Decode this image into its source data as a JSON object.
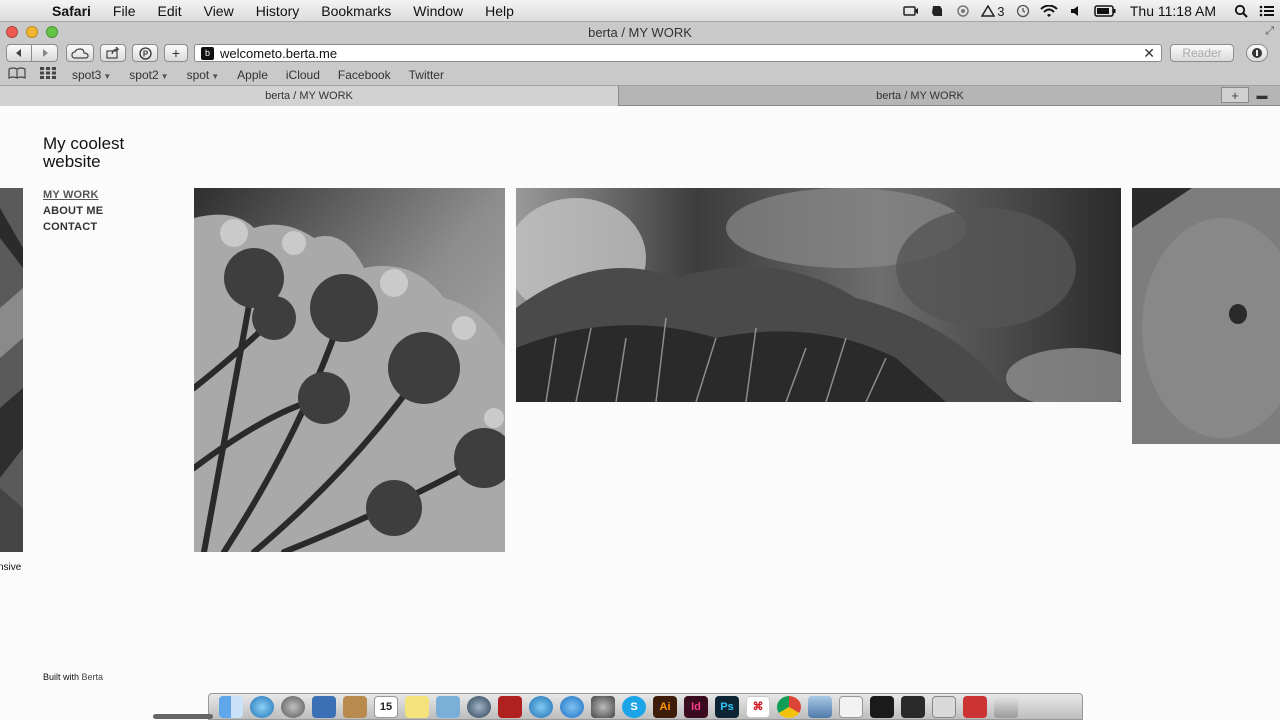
{
  "menubar": {
    "app_name": "Safari",
    "menus": [
      "File",
      "Edit",
      "View",
      "History",
      "Bookmarks",
      "Window",
      "Help"
    ],
    "status_icons": [
      "camera-icon",
      "evernote-icon",
      "sync-icon",
      "adobe-icon",
      "time-machine-icon",
      "wifi-icon",
      "volume-icon",
      "battery-icon"
    ],
    "adobe_count": "3",
    "clock": "Thu 11:18 AM"
  },
  "window": {
    "title": "berta / MY WORK"
  },
  "toolbar": {
    "url": "welcometo.berta.me",
    "favicon_letter": "b",
    "reader_label": "Reader",
    "add_label": "+"
  },
  "bookmarks": {
    "items": [
      {
        "label": "spot3",
        "has_menu": true
      },
      {
        "label": "spot2",
        "has_menu": true
      },
      {
        "label": "spot",
        "has_menu": true
      },
      {
        "label": "Apple",
        "has_menu": false
      },
      {
        "label": "iCloud",
        "has_menu": false
      },
      {
        "label": "Facebook",
        "has_menu": false
      },
      {
        "label": "Twitter",
        "has_menu": false
      }
    ]
  },
  "tabs": [
    {
      "label": "berta / MY WORK",
      "active": true
    },
    {
      "label": "berta / MY WORK",
      "active": false
    }
  ],
  "page": {
    "site_title": "My coolest website",
    "nav": [
      {
        "label": "MY WORK",
        "current": true
      },
      {
        "label": "ABOUT ME",
        "current": false
      },
      {
        "label": "CONTACT",
        "current": false
      }
    ],
    "caption_fragment": "nsive",
    "footer_prefix": "Built with",
    "footer_brand": "Berta"
  },
  "dock": {
    "apps": [
      "finder",
      "safari",
      "launchpad",
      "preview",
      "contacts",
      "calendar",
      "notes",
      "photos",
      "quicktime",
      "photo-booth",
      "itunes",
      "app-store",
      "system-preferences",
      "skype",
      "illustrator",
      "indesign",
      "photoshop",
      "acrobat",
      "chrome",
      "mail",
      "documents",
      "terminal",
      "screenshot",
      "calculator",
      "trash"
    ],
    "calendar_day": "15",
    "illustrator_label": "Ai",
    "indesign_label": "Id",
    "photoshop_label": "Ps",
    "skype_label": "S"
  }
}
